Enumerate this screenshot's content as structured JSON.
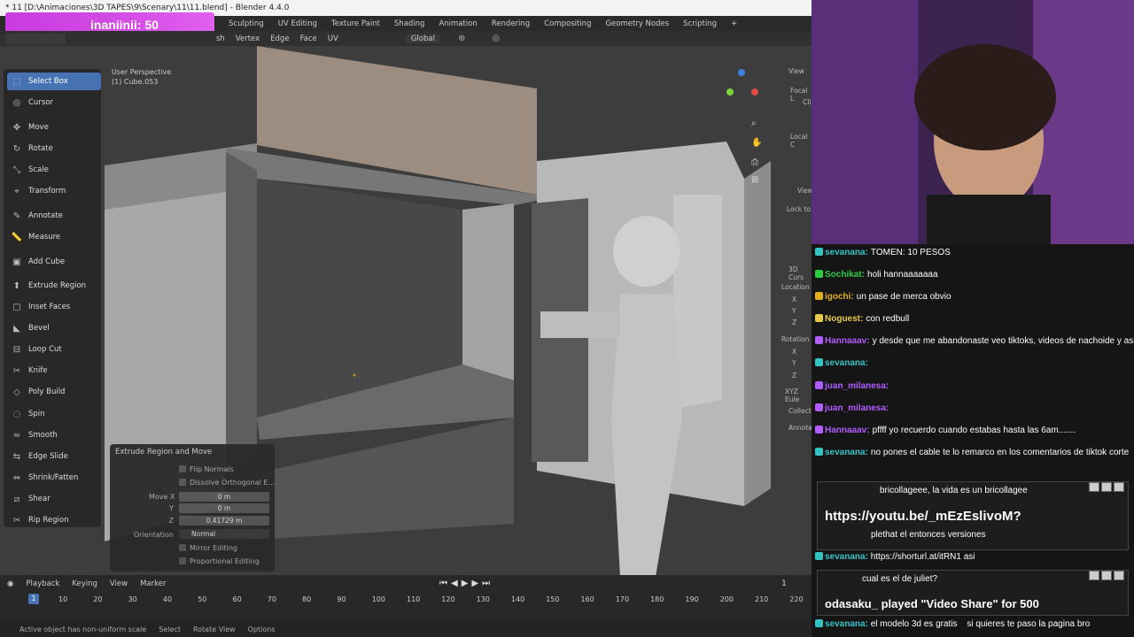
{
  "window": {
    "title": "* 11 [D:\\Animaciones\\3D TAPES\\9\\Scenary\\11\\11.blend] - Blender 4.4.0"
  },
  "overlay": {
    "label": "inaniinii: 50"
  },
  "workspaces": [
    "Sculpting",
    "UV Editing",
    "Texture Paint",
    "Shading",
    "Animation",
    "Rendering",
    "Compositing",
    "Geometry Nodes",
    "Scripting",
    "+"
  ],
  "header": {
    "items": [
      "sh",
      "Vertex",
      "Edge",
      "Face",
      "UV"
    ],
    "orientation": "Global"
  },
  "viewport": {
    "perspective": "User Perspective",
    "object": "(1) Cube.053"
  },
  "toolbar": {
    "items": [
      {
        "label": "Select Box",
        "icon": "select-box-icon",
        "active": true
      },
      {
        "label": "Cursor",
        "icon": "cursor-icon"
      },
      {
        "label": "Move",
        "icon": "move-icon"
      },
      {
        "label": "Rotate",
        "icon": "rotate-icon"
      },
      {
        "label": "Scale",
        "icon": "scale-icon"
      },
      {
        "label": "Transform",
        "icon": "transform-icon"
      },
      {
        "label": "Annotate",
        "icon": "annotate-icon"
      },
      {
        "label": "Measure",
        "icon": "measure-icon"
      },
      {
        "label": "Add Cube",
        "icon": "add-cube-icon"
      },
      {
        "label": "Extrude Region",
        "icon": "extrude-icon"
      },
      {
        "label": "Inset Faces",
        "icon": "inset-icon"
      },
      {
        "label": "Bevel",
        "icon": "bevel-icon"
      },
      {
        "label": "Loop Cut",
        "icon": "loop-cut-icon"
      },
      {
        "label": "Knife",
        "icon": "knife-icon"
      },
      {
        "label": "Poly Build",
        "icon": "poly-build-icon"
      },
      {
        "label": "Spin",
        "icon": "spin-icon"
      },
      {
        "label": "Smooth",
        "icon": "smooth-icon"
      },
      {
        "label": "Edge Slide",
        "icon": "edge-slide-icon"
      },
      {
        "label": "Shrink/Fatten",
        "icon": "shrink-icon"
      },
      {
        "label": "Shear",
        "icon": "shear-icon"
      },
      {
        "label": "Rip Region",
        "icon": "rip-icon"
      }
    ]
  },
  "operator": {
    "title": "Extrude Region and Move",
    "flip_normals": "Flip Normals",
    "dissolve": "Dissolve Orthogonal E...",
    "move_x_label": "Move X",
    "move_x": "0 m",
    "y_label": "Y",
    "y": "0 m",
    "z_label": "Z",
    "z": "0.41729 m",
    "orientation_label": "Orientation",
    "orientation": "Normal",
    "mirror": "Mirror Editing",
    "proportional": "Proportional Editing"
  },
  "right_panel": {
    "view": "View",
    "focal": "Focal L",
    "clip": "Cli",
    "local": "Local C",
    "view2": "View",
    "lock": "Lock to",
    "cursor3d": "3D Curs",
    "location": "Location",
    "x": "X",
    "y": "Y",
    "z": "Z",
    "rotation": "Rotation",
    "rx": "X",
    "ry": "Y",
    "rz": "Z",
    "euler": "XYZ Eule",
    "collection": "Collecti",
    "annotations": "Annotat"
  },
  "timeline": {
    "menus": [
      "Playback",
      "Keying",
      "View",
      "Marker"
    ],
    "current_frame": "1",
    "frame_marker": "1",
    "ticks": [
      "10",
      "20",
      "30",
      "40",
      "50",
      "60",
      "70",
      "80",
      "90",
      "100",
      "110",
      "120",
      "130",
      "140",
      "150",
      "160",
      "170",
      "180",
      "190",
      "200",
      "210",
      "220"
    ]
  },
  "status": {
    "items": [
      "Active object has non-uniform scale",
      "Select",
      "Rotate View",
      "Options"
    ]
  },
  "chat": {
    "messages": [
      {
        "user": "sevanana:",
        "text": "TOMEN: 10 PESOS",
        "color": "#34c3c3"
      },
      {
        "user": "Sochikat:",
        "text": "holi hannaaaaaaa",
        "color": "#2ecc40"
      },
      {
        "user": "igochi:",
        "text": "un pase de merca obvio",
        "color": "#e0b020"
      },
      {
        "user": "Noguest:",
        "text": "con redbull",
        "color": "#e8c84a"
      },
      {
        "user": "Hannaaav:",
        "text": "y desde que me abandonaste veo tiktoks, videos de nachoide y asi",
        "color": "#b05cff"
      },
      {
        "user": "sevanana:",
        "text": "",
        "color": "#34c3c3"
      },
      {
        "user": "juan_milanesa:",
        "text": "",
        "color": "#b05cff"
      },
      {
        "user": "juan_milanesa:",
        "text": "",
        "color": "#b05cff"
      },
      {
        "user": "Hannaaav:",
        "text": "pffff yo recuerdo cuando estabas hasta las 6am.......",
        "color": "#b05cff"
      },
      {
        "user": "sevanana:",
        "text": "no pones el cable te lo remarco en los comentarios de tiktok corte",
        "color": "#34c3c3"
      }
    ],
    "popup1": {
      "text": "bricollageee, la vida es un bricollagee",
      "link": "https://youtu.be/_mEzEslivoM?",
      "sub": "plethat el entonces versiones"
    },
    "link_msg": {
      "user": "sevanana:",
      "text": "https://shorturl.at/itRN1 asi"
    },
    "popup2": {
      "text": "cual es el de juliet?",
      "played": "odasaku_ played \"Video Share\" for 500"
    },
    "last": {
      "user": "sevanana:",
      "text": "el modelo 3d es gratis",
      "extra": "si quieres te paso la pagina bro"
    }
  }
}
